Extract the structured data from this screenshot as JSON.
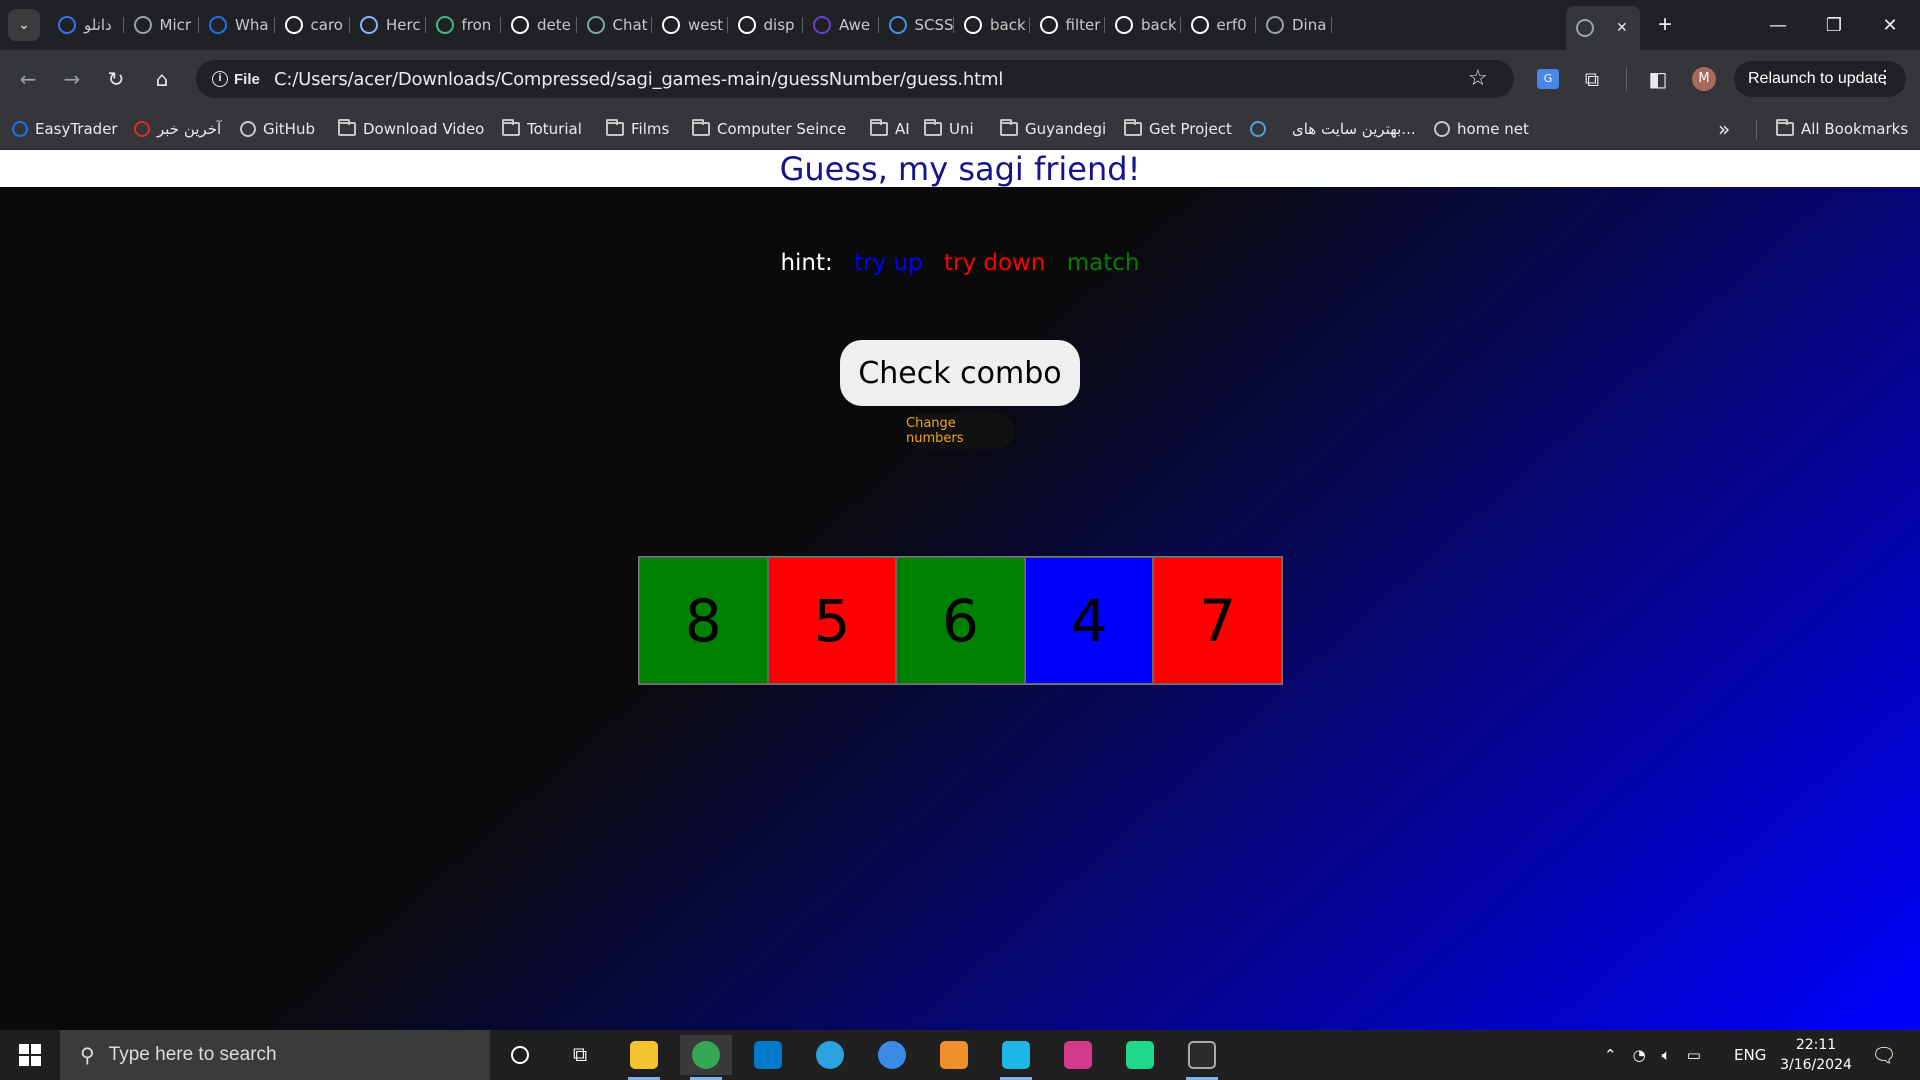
{
  "browser": {
    "tabs": [
      {
        "label": "دانلو",
        "icon": "s-logo-icon",
        "color": "#3b6ff5"
      },
      {
        "label": "Micr",
        "icon": "globe-icon",
        "color": "#9aa0a6"
      },
      {
        "label": "Wha",
        "icon": "blue-logo-icon",
        "color": "#1a73e8"
      },
      {
        "label": "caro",
        "icon": "google-icon",
        "color": "#ffffff"
      },
      {
        "label": "Herc",
        "icon": "shield-icon",
        "color": "#8ab4f8"
      },
      {
        "label": "fron",
        "icon": "vue-icon",
        "color": "#42b883"
      },
      {
        "label": "dete",
        "icon": "google-icon",
        "color": "#ffffff"
      },
      {
        "label": "Chat",
        "icon": "chatgpt-icon",
        "color": "#74aa9c"
      },
      {
        "label": "west",
        "icon": "github-icon",
        "color": "#ffffff"
      },
      {
        "label": "disp",
        "icon": "google-icon",
        "color": "#ffffff"
      },
      {
        "label": "Awe",
        "icon": "six-icon",
        "color": "#6b3fd1"
      },
      {
        "label": "SCSS",
        "icon": "stack-icon",
        "color": "#4a90e2"
      },
      {
        "label": "back",
        "icon": "google-icon",
        "color": "#ffffff"
      },
      {
        "label": "filter",
        "icon": "m-icon",
        "color": "#ffffff"
      },
      {
        "label": "back",
        "icon": "m-icon",
        "color": "#ffffff"
      },
      {
        "label": "erf0",
        "icon": "github-icon",
        "color": "#ffffff"
      },
      {
        "label": "Dina",
        "icon": "globe-icon",
        "color": "#9aa0a6"
      },
      {
        "label": "",
        "icon": "globe-icon",
        "color": "#9aa0a6"
      }
    ],
    "new_tab": "+",
    "url_chip": "File",
    "url": "C:/Users/acer/Downloads/Compressed/sagi_games-main/guessNumber/guess.html",
    "relaunch": "Relaunch to update",
    "profile_initial": "M",
    "bookmarks": [
      {
        "label": "EasyTrader",
        "icon": "chart-logo-icon"
      },
      {
        "label": "آخرین خبر",
        "icon": "news-logo-icon"
      },
      {
        "label": "GitHub",
        "icon": "github-icon"
      },
      {
        "label": "Download Video",
        "icon": "folder-icon"
      },
      {
        "label": "Toturial",
        "icon": "folder-icon"
      },
      {
        "label": "Films",
        "icon": "folder-icon"
      },
      {
        "label": "Computer Seince",
        "icon": "folder-icon"
      },
      {
        "label": "AI",
        "icon": "folder-icon"
      },
      {
        "label": "Uni",
        "icon": "folder-icon"
      },
      {
        "label": "Guyandegi",
        "icon": "folder-icon"
      },
      {
        "label": "Get Project",
        "icon": "folder-icon"
      },
      {
        "label": "",
        "icon": "blue-logo-icon"
      },
      {
        "label": "بهترین سایت های...",
        "icon": ""
      },
      {
        "label": "home net",
        "icon": "globe-icon"
      }
    ],
    "more_bookmarks": "»",
    "all_bookmarks": "All Bookmarks"
  },
  "page": {
    "title": "Guess, my sagi friend!",
    "hint_label": "hint:",
    "hints": [
      {
        "label": "try up",
        "color": "#0000ff"
      },
      {
        "label": "try down",
        "color": "#ff0000"
      },
      {
        "label": "match",
        "color": "#008000"
      }
    ],
    "check_button": "Check combo",
    "change_button": "Change numbers",
    "boxes": [
      {
        "value": "8",
        "color": "#008000"
      },
      {
        "value": "5",
        "color": "#ff0000"
      },
      {
        "value": "6",
        "color": "#008000"
      },
      {
        "value": "4",
        "color": "#0000ff"
      },
      {
        "value": "7",
        "color": "#ff0000"
      }
    ]
  },
  "taskbar": {
    "search_placeholder": "Type here to search",
    "apps": [
      {
        "name": "file-explorer",
        "color": "#f4c430"
      },
      {
        "name": "chrome",
        "color": "#34a853"
      },
      {
        "name": "vscode",
        "color": "#007acc"
      },
      {
        "name": "telegram",
        "color": "#2aa3df"
      },
      {
        "name": "browser",
        "color": "#3c8ce7"
      },
      {
        "name": "search-tool",
        "color": "#f0902a"
      },
      {
        "name": "webstorm",
        "color": "#1fb6e6"
      },
      {
        "name": "intellij",
        "color": "#d33a8c"
      },
      {
        "name": "pycharm",
        "color": "#21d789"
      },
      {
        "name": "terminal",
        "color": "#2b2b2b"
      }
    ],
    "lang": "ENG",
    "time": "22:11",
    "date": "3/16/2024"
  }
}
